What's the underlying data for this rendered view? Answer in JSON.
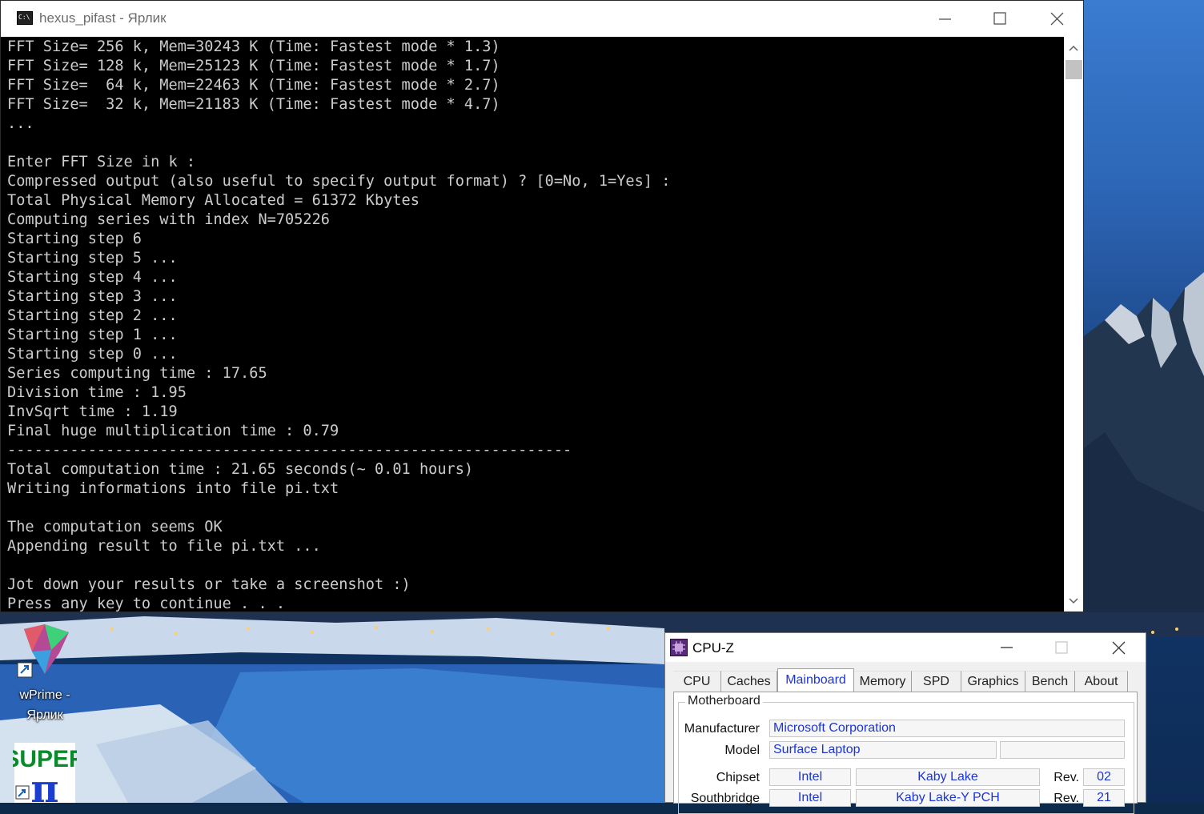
{
  "console": {
    "title": "hexus_pifast - Ярлик",
    "icon_text": "C:\\",
    "lines": [
      "FFT Size= 256 k, Mem=30243 K (Time: Fastest mode * 1.3)",
      "FFT Size= 128 k, Mem=25123 K (Time: Fastest mode * 1.7)",
      "FFT Size=  64 k, Mem=22463 K (Time: Fastest mode * 2.7)",
      "FFT Size=  32 k, Mem=21183 K (Time: Fastest mode * 4.7)",
      "...",
      "",
      "Enter FFT Size in k :",
      "Compressed output (also useful to specify output format) ? [0=No, 1=Yes] :",
      "Total Physical Memory Allocated = 61372 Kbytes",
      "Computing series with index N=705226",
      "Starting step 6",
      "Starting step 5 ...",
      "Starting step 4 ...",
      "Starting step 3 ...",
      "Starting step 2 ...",
      "Starting step 1 ...",
      "Starting step 0 ...",
      "Series computing time : 17.65",
      "Division time : 1.95",
      "InvSqrt time : 1.19",
      "Final huge multiplication time : 0.79",
      "---------------------------------------------------------------",
      "Total computation time : 21.65 seconds(~ 0.01 hours)",
      "Writing informations into file pi.txt",
      "",
      "The computation seems OK",
      "Appending result to file pi.txt ...",
      "",
      "Jot down your results or take a screenshot :)",
      "Press any key to continue . . ."
    ]
  },
  "desktop": {
    "icons": [
      {
        "name": "wprime",
        "label_line1": "wPrime -",
        "label_line2": "Ярлик"
      },
      {
        "name": "superpi",
        "logo_text_top": "SUPER",
        "logo_text_bottom": "π"
      }
    ]
  },
  "cpuz": {
    "title": "CPU-Z",
    "tabs": [
      "CPU",
      "Caches",
      "Mainboard",
      "Memory",
      "SPD",
      "Graphics",
      "Bench",
      "About"
    ],
    "active_tab": "Mainboard",
    "group_title": "Motherboard",
    "manufacturer_label": "Manufacturer",
    "manufacturer_value": "Microsoft Corporation",
    "model_label": "Model",
    "model_value": "Surface Laptop",
    "model_extra": "",
    "chipset_label": "Chipset",
    "chipset_vendor": "Intel",
    "chipset_name": "Kaby Lake",
    "chipset_rev_label": "Rev.",
    "chipset_rev": "02",
    "southbridge_label": "Southbridge",
    "southbridge_vendor": "Intel",
    "southbridge_name": "Kaby Lake-Y PCH",
    "southbridge_rev_label": "Rev.",
    "southbridge_rev": "21",
    "accent_color": "#1b35d6"
  }
}
